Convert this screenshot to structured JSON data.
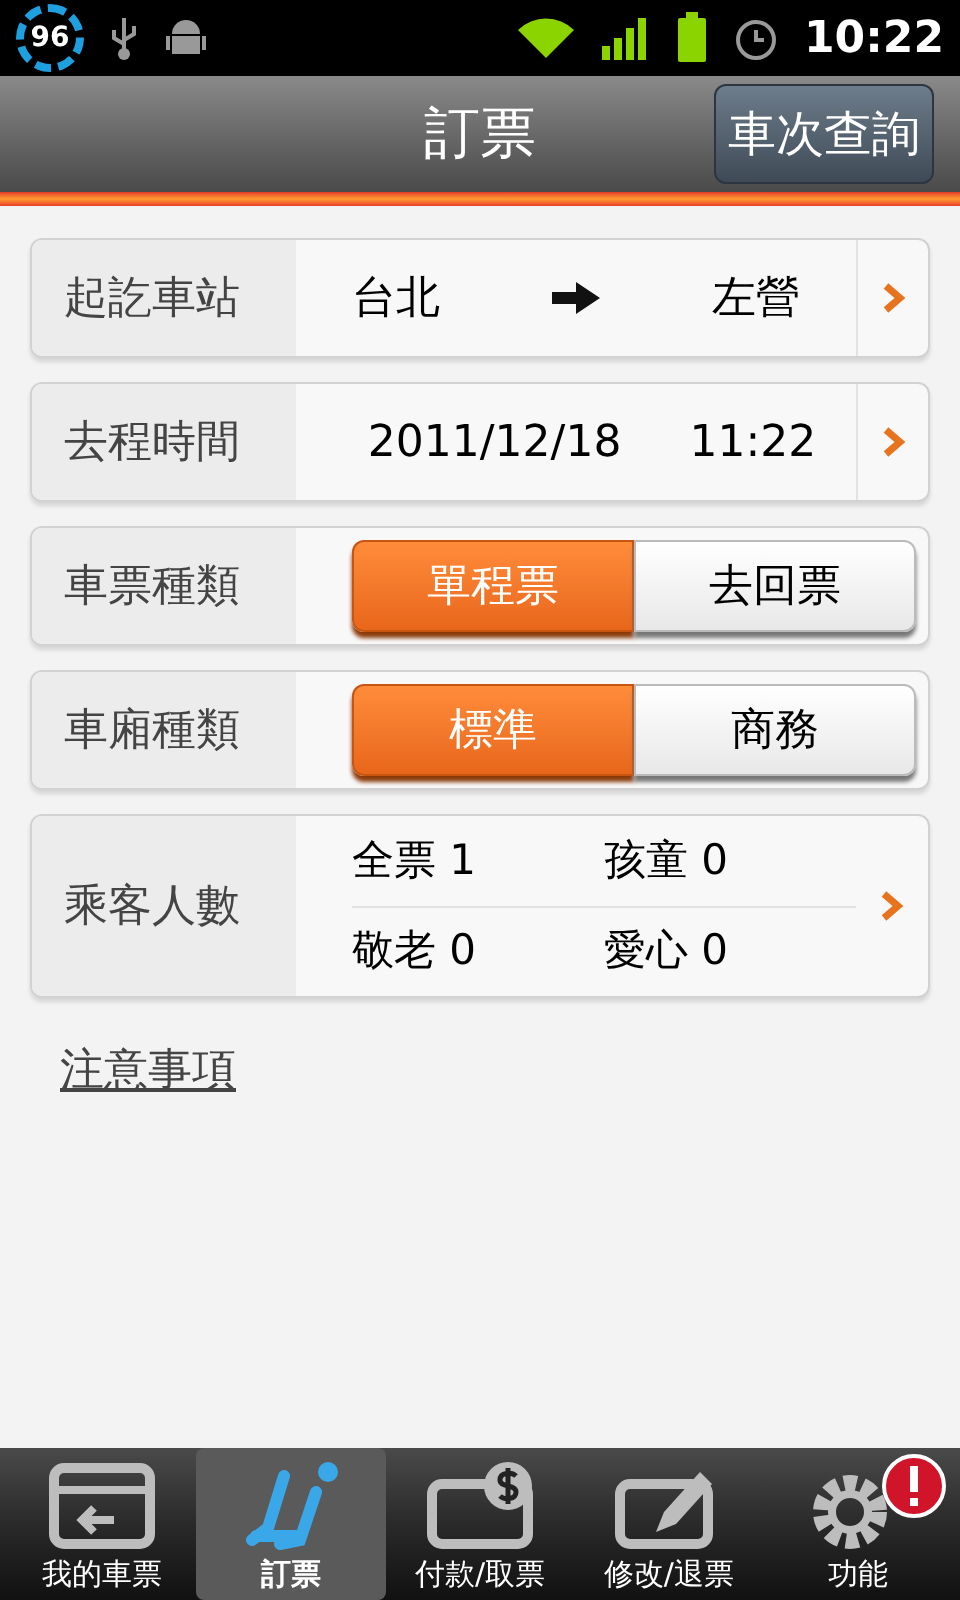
{
  "status_bar": {
    "battery_percent": "96",
    "time": "10:22"
  },
  "header": {
    "title": "訂票",
    "button": "車次查詢"
  },
  "rows": [
    {
      "kind": "route",
      "label": "起訖車站",
      "from": "台北",
      "to": "左營"
    },
    {
      "kind": "datetime",
      "label": "去程時間",
      "date": "2011/12/18",
      "time": "11:22"
    },
    {
      "kind": "segmented",
      "label": "車票種類",
      "options": [
        {
          "label": "單程票",
          "selected": true
        },
        {
          "label": "去回票",
          "selected": false
        }
      ]
    },
    {
      "kind": "segmented",
      "label": "車廂種類",
      "options": [
        {
          "label": "標準",
          "selected": true
        },
        {
          "label": "商務",
          "selected": false
        }
      ]
    },
    {
      "kind": "passengers",
      "label": "乘客人數",
      "counts": [
        "全票 1",
        "孩童 0",
        "敬老 0",
        "愛心 0"
      ]
    }
  ],
  "notice_link": "注意事項",
  "bottom_nav": [
    {
      "kind": "tickets",
      "label": "我的車票",
      "selected": false
    },
    {
      "kind": "booking",
      "label": "訂票",
      "selected": true
    },
    {
      "kind": "payment",
      "label": "付款/取票",
      "selected": false
    },
    {
      "kind": "edit",
      "label": "修改/退票",
      "selected": false
    },
    {
      "kind": "settings",
      "label": "功能",
      "selected": false,
      "alert": true
    }
  ]
}
